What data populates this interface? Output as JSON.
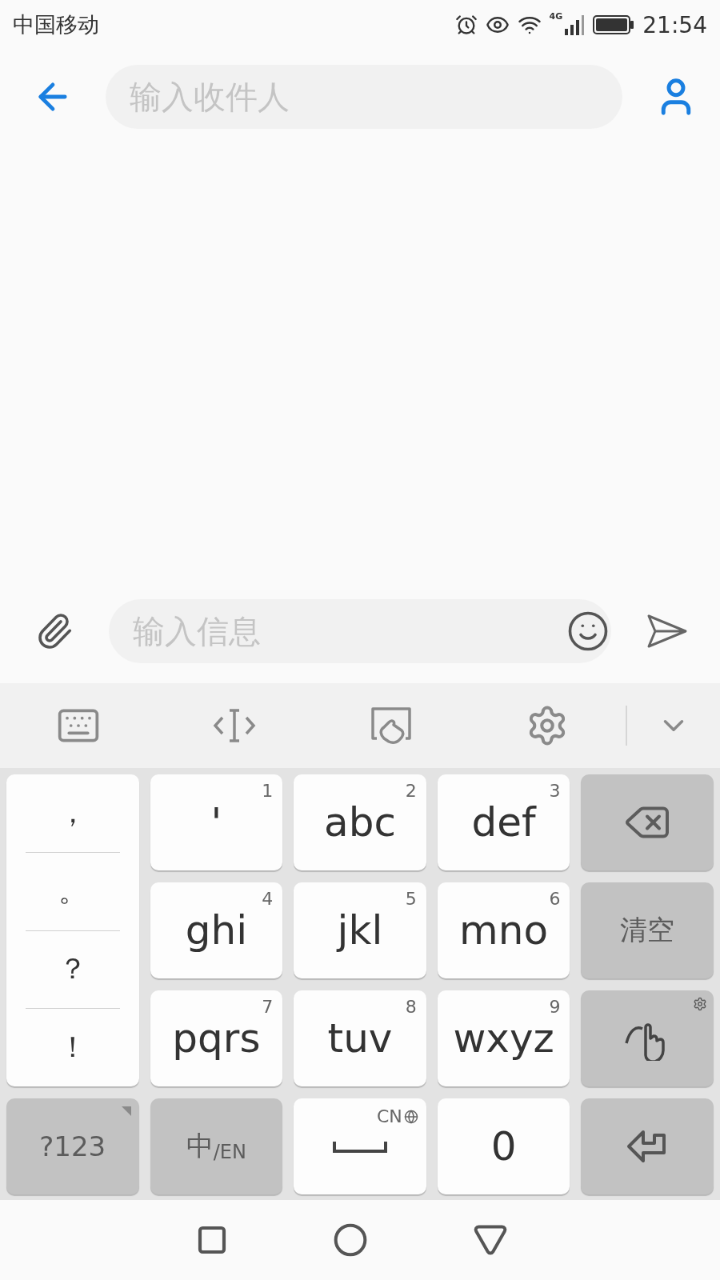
{
  "status_bar": {
    "carrier": "中国移动",
    "network": "4G",
    "time": "21:54"
  },
  "header": {
    "recipient_field": {
      "placeholder": "输入收件人"
    }
  },
  "compose": {
    "message_field": {
      "placeholder": "输入信息"
    }
  },
  "keyboard": {
    "punctuation": [
      "，",
      "。",
      "？",
      "！"
    ],
    "rows": [
      [
        {
          "kind": "letter",
          "label": "'",
          "digit": "1"
        },
        {
          "kind": "letter",
          "label": "abc",
          "digit": "2"
        },
        {
          "kind": "letter",
          "label": "def",
          "digit": "3"
        },
        {
          "kind": "delete"
        }
      ],
      [
        {
          "kind": "letter",
          "label": "ghi",
          "digit": "4"
        },
        {
          "kind": "letter",
          "label": "jkl",
          "digit": "5"
        },
        {
          "kind": "letter",
          "label": "mno",
          "digit": "6"
        },
        {
          "kind": "function",
          "label": "清空"
        }
      ],
      [
        {
          "kind": "letter",
          "label": "pqrs",
          "digit": "7"
        },
        {
          "kind": "letter",
          "label": "tuv",
          "digit": "8"
        },
        {
          "kind": "letter",
          "label": "wxyz",
          "digit": "9"
        },
        {
          "kind": "gesture"
        }
      ]
    ],
    "bottom_row": [
      {
        "kind": "function",
        "label": "?123"
      },
      {
        "kind": "function",
        "label": "中$_{/EN}$"
      },
      {
        "kind": "space",
        "hint": "CN"
      },
      {
        "kind": "letter",
        "label": "0"
      },
      {
        "kind": "enter"
      }
    ]
  }
}
